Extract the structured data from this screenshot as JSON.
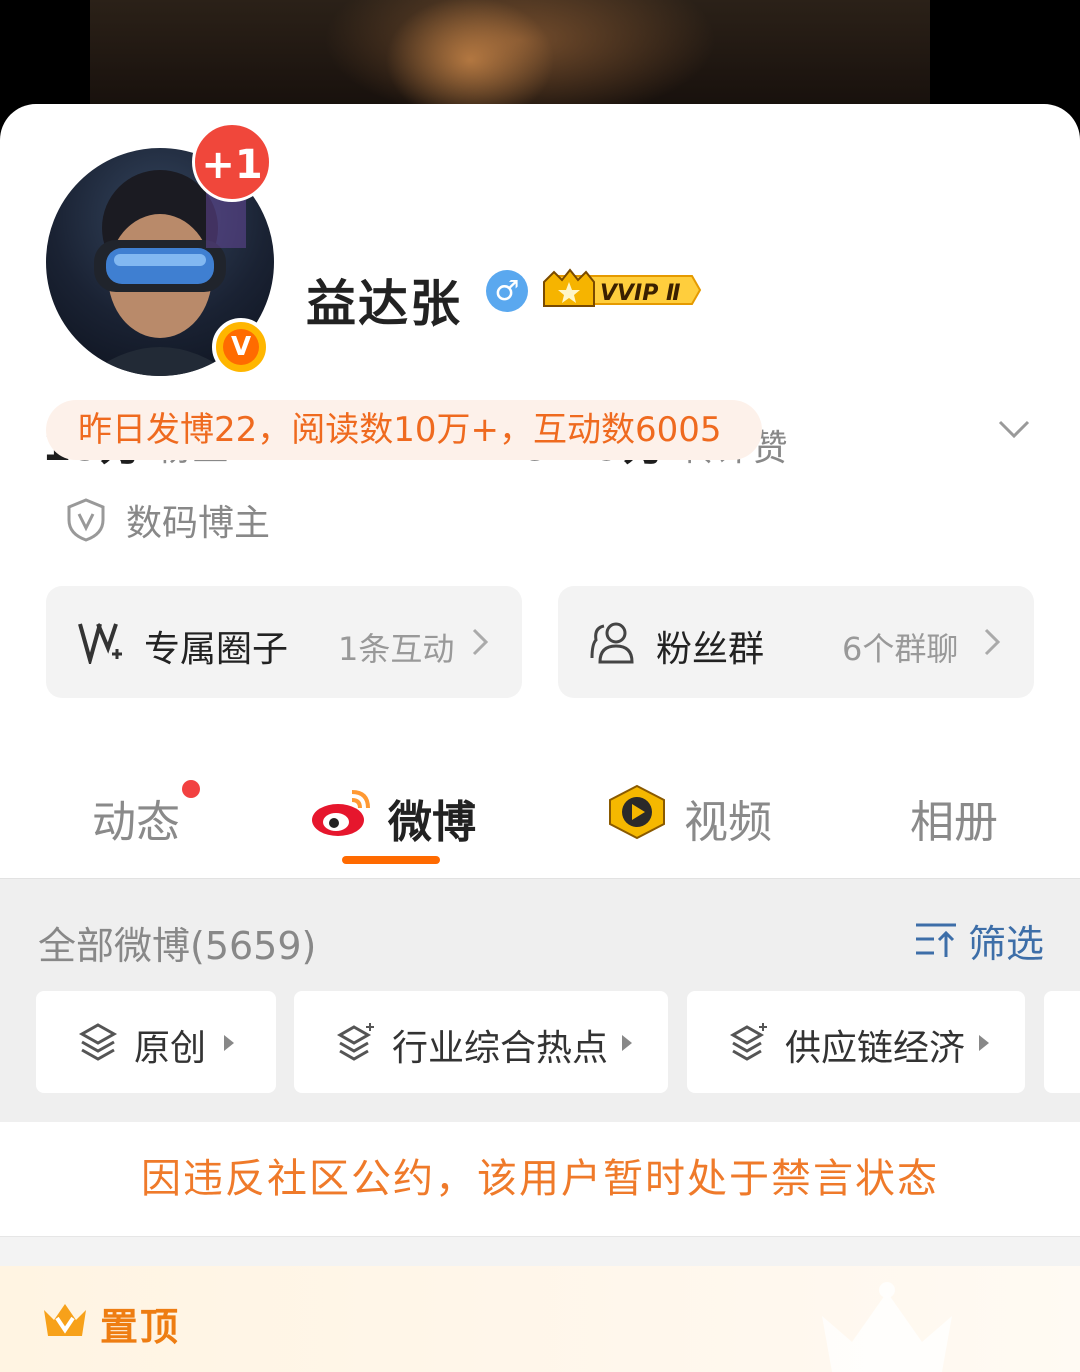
{
  "profile": {
    "name": "益达张",
    "gender_symbol": "♂",
    "vip_label": "VVIP Ⅱ",
    "notification_badge": "+1",
    "verified_letter": "V"
  },
  "stats": [
    {
      "value": "15万",
      "label": "粉丝"
    },
    {
      "value": "1695",
      "label": "关注"
    },
    {
      "value": "82.9万",
      "label": "转评赞"
    }
  ],
  "summary_pill": "昨日发博22，阅读数10万+，互动数6005",
  "tag": "数码博主",
  "tiles": [
    {
      "title": "专属圈子",
      "sub": "1条互动"
    },
    {
      "title": "粉丝群",
      "sub": "6个群聊"
    }
  ],
  "tabs": [
    {
      "label": "动态"
    },
    {
      "label": "微博"
    },
    {
      "label": "视频"
    },
    {
      "label": "相册"
    }
  ],
  "feed": {
    "all_label": "全部微博(5659)",
    "filter_label": "筛选",
    "chips": [
      "原创",
      "行业综合热点",
      "供应链经济"
    ]
  },
  "notice": "因违反社区公约，该用户暂时处于禁言状态",
  "pinned_label": "置顶",
  "colors": {
    "accent": "#ff6a00",
    "notice": "#ef7a2a",
    "filter": "#3d6ea8",
    "pill_bg": "#fdf1ea"
  }
}
